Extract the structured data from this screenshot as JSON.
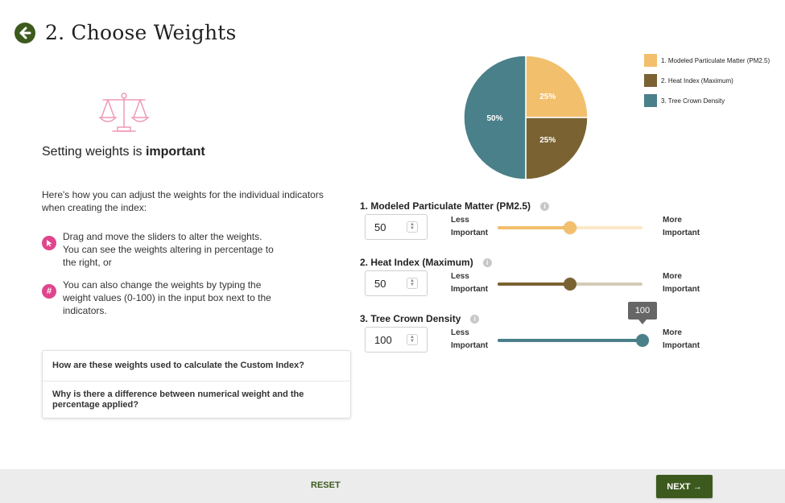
{
  "header": {
    "title": "2. Choose Weights",
    "back_icon": "arrow-left-circle-icon"
  },
  "intro": {
    "title_prefix": "Setting weights is ",
    "title_emphasis": "important",
    "description": "Here's how you can adjust the weights for the individual indicators when creating the index:",
    "tips": [
      {
        "icon": "cursor-icon",
        "text": "Drag and move the sliders to alter the weights. You can see the weights altering in percentage to the right, or"
      },
      {
        "icon": "hash-icon",
        "glyph": "#",
        "text": "You can also change the weights by typing the weight values (0-100) in the input box next to the indicators."
      }
    ]
  },
  "faq": [
    "How are these weights used to calculate the Custom Index?",
    "Why is there a difference between numerical weight and the percentage applied?"
  ],
  "legend": [
    {
      "label": "1. Modeled Particulate Matter (PM2.5)",
      "color": "#f2bf6c"
    },
    {
      "label": "2. Heat Index (Maximum)",
      "color": "#7a6232"
    },
    {
      "label": "3. Tree Crown Density",
      "color": "#4a8089"
    }
  ],
  "chart_data": {
    "type": "pie",
    "categories": [
      "1. Modeled Particulate Matter (PM2.5)",
      "2. Heat Index (Maximum)",
      "3. Tree Crown Density"
    ],
    "values": [
      25,
      25,
      50
    ],
    "labels": [
      "25%",
      "25%",
      "50%"
    ],
    "colors": [
      "#f2bf6c",
      "#7a6232",
      "#4a8089"
    ]
  },
  "indicators": [
    {
      "title": "1. Modeled Particulate Matter (PM2.5)",
      "value": "50",
      "weight": 50,
      "less_label": "Less\nImportant",
      "more_label": "More\nImportant",
      "color": "#f2bf6c",
      "track_color": "#fbe8c6",
      "info_icon": "info-icon"
    },
    {
      "title": "2. Heat Index (Maximum)",
      "value": "50",
      "weight": 50,
      "less_label": "Less\nImportant",
      "more_label": "More\nImportant",
      "color": "#7a6232",
      "track_color": "#d4cbb8",
      "info_icon": "info-icon"
    },
    {
      "title": "3. Tree Crown Density",
      "value": "100",
      "weight": 100,
      "less_label": "Less\nImportant",
      "more_label": "More\nImportant",
      "color": "#4a8089",
      "track_color": "#b7d0d3",
      "tooltip": "100",
      "info_icon": "info-icon"
    }
  ],
  "footer": {
    "reset_label": "RESET",
    "next_label": "NEXT →"
  }
}
